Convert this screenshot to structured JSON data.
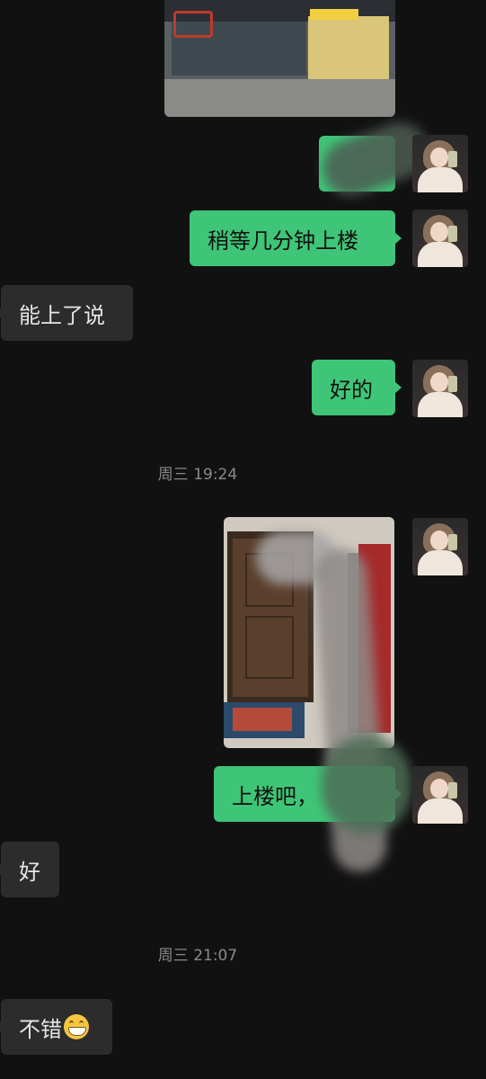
{
  "chat": {
    "messages": {
      "m1_image": "photo",
      "m2_image": "photo-green-blurred",
      "m3_text": "稍等几分钟上楼",
      "m4_text": "能上了说",
      "m5_text": "好的",
      "ts1": "周三 19:24",
      "m6_image": "photo-door",
      "m7_text": "上楼吧，",
      "m8_text": "好",
      "ts2": "周三 21:07",
      "m9_text": "不错",
      "m9_emoji": "grinning-face-emoji"
    }
  },
  "colors": {
    "background": "#111111",
    "outgoing_bubble": "#3fc577",
    "incoming_bubble": "#2c2c2c",
    "timestamp_text": "#8a8a8a"
  }
}
